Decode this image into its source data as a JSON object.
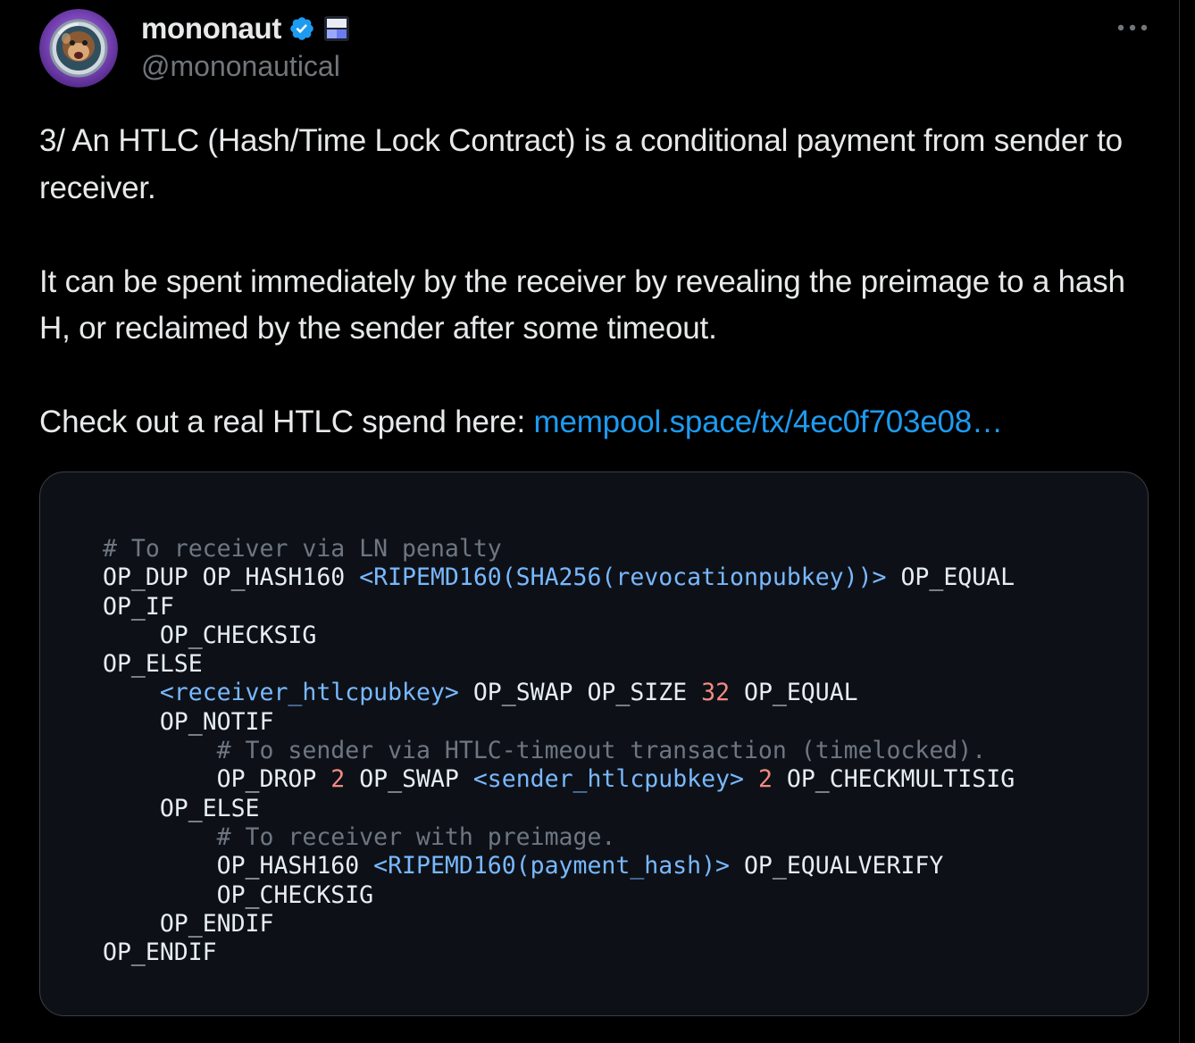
{
  "author": {
    "display_name": "mononaut",
    "handle": "@mononautical",
    "avatar_icon": "astronaut-monkey-avatar",
    "verified_icon": "verified-badge-icon",
    "affiliate_icon": "affiliate-badge-icon"
  },
  "more_icon": "more-dots-icon",
  "tweet": {
    "paragraph_1": "3/ An HTLC (Hash/Time Lock Contract) is a conditional payment from sender to receiver.",
    "paragraph_2": "It can be spent immediately by the receiver by revealing the preimage to a hash H, or reclaimed by the sender after some timeout.",
    "paragraph_3_prefix": "Check out a real HTLC spend here: ",
    "link_text": "mempool.space/tx/4ec0f703e08…"
  },
  "colors": {
    "background": "#000000",
    "text": "#e7e9ea",
    "secondary_text": "#71767b",
    "link": "#1d9bf0",
    "code_background": "#0d1117",
    "code_comment": "#6e7681",
    "code_placeholder": "#79b8ff",
    "code_number": "#f28b82"
  },
  "code_image": {
    "lines": [
      {
        "indent": 0,
        "tokens": [
          {
            "t": "comment",
            "v": "# To receiver via LN penalty"
          }
        ]
      },
      {
        "indent": 0,
        "tokens": [
          {
            "t": "op",
            "v": "OP_DUP OP_HASH160 "
          },
          {
            "t": "var",
            "v": "<RIPEMD160(SHA256(revocationpubkey))>"
          },
          {
            "t": "op",
            "v": " OP_EQUAL"
          }
        ]
      },
      {
        "indent": 0,
        "tokens": [
          {
            "t": "op",
            "v": "OP_IF"
          }
        ]
      },
      {
        "indent": 1,
        "tokens": [
          {
            "t": "op",
            "v": "OP_CHECKSIG"
          }
        ]
      },
      {
        "indent": 0,
        "tokens": [
          {
            "t": "op",
            "v": "OP_ELSE"
          }
        ]
      },
      {
        "indent": 1,
        "tokens": [
          {
            "t": "var",
            "v": "<receiver_htlcpubkey>"
          },
          {
            "t": "op",
            "v": " OP_SWAP OP_SIZE "
          },
          {
            "t": "num",
            "v": "32"
          },
          {
            "t": "op",
            "v": " OP_EQUAL"
          }
        ]
      },
      {
        "indent": 1,
        "tokens": [
          {
            "t": "op",
            "v": "OP_NOTIF"
          }
        ]
      },
      {
        "indent": 2,
        "tokens": [
          {
            "t": "comment",
            "v": "# To sender via HTLC-timeout transaction (timelocked)."
          }
        ]
      },
      {
        "indent": 2,
        "tokens": [
          {
            "t": "op",
            "v": "OP_DROP "
          },
          {
            "t": "num",
            "v": "2"
          },
          {
            "t": "op",
            "v": " OP_SWAP "
          },
          {
            "t": "var",
            "v": "<sender_htlcpubkey>"
          },
          {
            "t": "op",
            "v": " "
          },
          {
            "t": "num",
            "v": "2"
          },
          {
            "t": "op",
            "v": " OP_CHECKMULTISIG"
          }
        ]
      },
      {
        "indent": 1,
        "tokens": [
          {
            "t": "op",
            "v": "OP_ELSE"
          }
        ]
      },
      {
        "indent": 2,
        "tokens": [
          {
            "t": "comment",
            "v": "# To receiver with preimage."
          }
        ]
      },
      {
        "indent": 2,
        "tokens": [
          {
            "t": "op",
            "v": "OP_HASH160 "
          },
          {
            "t": "var",
            "v": "<RIPEMD160(payment_hash)>"
          },
          {
            "t": "op",
            "v": " OP_EQUALVERIFY"
          }
        ]
      },
      {
        "indent": 2,
        "tokens": [
          {
            "t": "op",
            "v": "OP_CHECKSIG"
          }
        ]
      },
      {
        "indent": 1,
        "tokens": [
          {
            "t": "op",
            "v": "OP_ENDIF"
          }
        ]
      },
      {
        "indent": 0,
        "tokens": [
          {
            "t": "op",
            "v": "OP_ENDIF"
          }
        ]
      }
    ]
  }
}
